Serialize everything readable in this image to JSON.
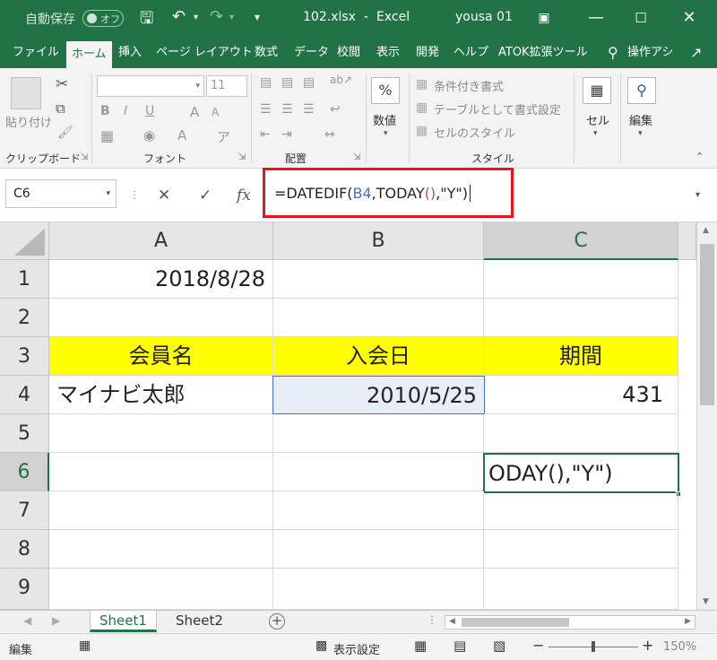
{
  "titlebar": {
    "autosave_label": "自動保存",
    "autosave_state": "オフ",
    "filename": "102.xlsx",
    "separator": "-",
    "app": "Excel",
    "user": "yousa 01"
  },
  "tabs": [
    "ファイル",
    "ホーム",
    "挿入",
    "ページ レイアウト",
    "数式",
    "データ",
    "校閲",
    "表示",
    "開発",
    "ヘルプ",
    "ATOK拡張ツール"
  ],
  "active_tab": "ホーム",
  "tell_me": "操作アシ",
  "ribbon": {
    "clipboard": {
      "paste": "貼り付け",
      "label": "クリップボード"
    },
    "font": {
      "size": "11",
      "bold": "B",
      "italic": "I",
      "underline": "U",
      "grow": "A",
      "shrink": "A",
      "fontcolor": "A",
      "label": "フォント"
    },
    "alignment": {
      "label": "配置"
    },
    "number": {
      "icon": "%",
      "label": "数値"
    },
    "styles": {
      "conditional": "条件付き書式",
      "table": "テーブルとして書式設定",
      "cell_styles": "セルのスタイル",
      "label": "スタイル"
    },
    "cells": {
      "label": "セル"
    },
    "editing": {
      "label": "編集"
    }
  },
  "formula_bar": {
    "namebox": "C6",
    "cancel": "✕",
    "enter": "✓",
    "fx": "fx",
    "formula_prefix": "=DATEDIF(",
    "formula_ref": "B4",
    "formula_mid": ",TODAY",
    "formula_paren": "()",
    "formula_suffix": ",\"Y\")"
  },
  "columns": [
    "A",
    "B",
    "C"
  ],
  "rows": [
    "1",
    "2",
    "3",
    "4",
    "5",
    "6",
    "7",
    "8",
    "9"
  ],
  "cells": {
    "A1": "2018/8/28",
    "A3": "会員名",
    "B3": "入会日",
    "C3": "期間",
    "A4": "マイナビ太郎",
    "B4": "2010/5/25",
    "C4": "431",
    "C6": "ODAY(),\"Y\")"
  },
  "sheets": [
    "Sheet1",
    "Sheet2"
  ],
  "active_sheet": "Sheet1",
  "status": {
    "mode": "編集",
    "display_settings": "表示設定",
    "zoom": "150%"
  },
  "colors": {
    "accent": "#217346",
    "header_fill": "#ffff00",
    "highlight_box": "#e8141c"
  }
}
